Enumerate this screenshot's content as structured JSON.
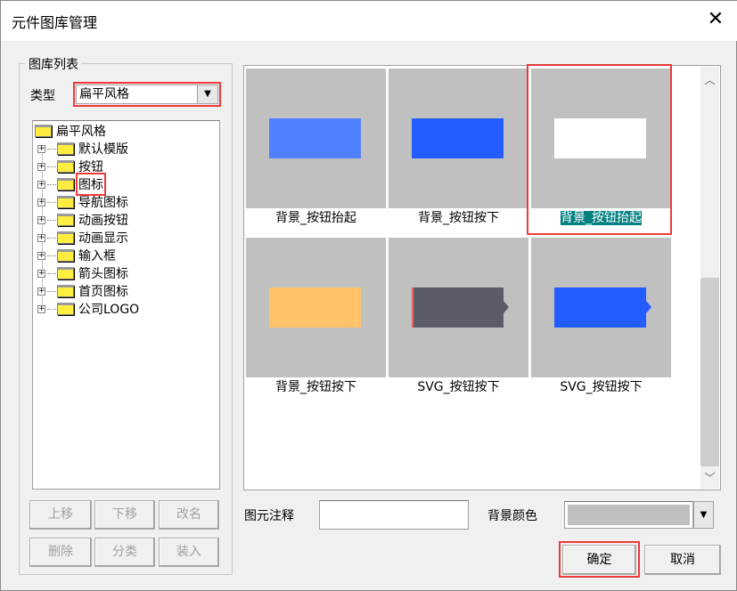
{
  "window": {
    "title": "元件图库管理",
    "close_icon": "close-icon"
  },
  "library": {
    "group_label": "图库列表",
    "type_label": "类型",
    "type_value": "扁平风格",
    "tree": {
      "root": "扁平风格",
      "children": [
        "默认模版",
        "按钮",
        "图标",
        "导航图标",
        "动画按钮",
        "动画显示",
        "输入框",
        "箭头图标",
        "首页图标",
        "公司LOGO"
      ],
      "highlighted": "图标"
    },
    "buttons": [
      "上移",
      "下移",
      "改名",
      "删除",
      "分类",
      "装入"
    ]
  },
  "gallery": {
    "items": [
      {
        "label": "背景_按钮抬起",
        "color": "#4f80ff",
        "selected": false
      },
      {
        "label": "背景_按钮按下",
        "color": "#235cff",
        "selected": false
      },
      {
        "label": "背景_按钮抬起",
        "color": "#ffffff",
        "selected": true
      },
      {
        "label": "背景_按钮按下",
        "color": "#ffc266",
        "selected": false
      },
      {
        "label": "SVG_按钮按下",
        "color": "#5c5c68",
        "selected": false
      },
      {
        "label": "SVG_按钮按下",
        "color": "#235cff",
        "selected": false
      }
    ]
  },
  "footer": {
    "note_label": "图元注释",
    "note_value": "",
    "bg_color_label": "背景颜色",
    "bg_color_value": "#c0c0c0",
    "ok": "确定",
    "cancel": "取消"
  },
  "colors": {
    "highlight_border": "#f03a3a",
    "selection": "#008080"
  }
}
